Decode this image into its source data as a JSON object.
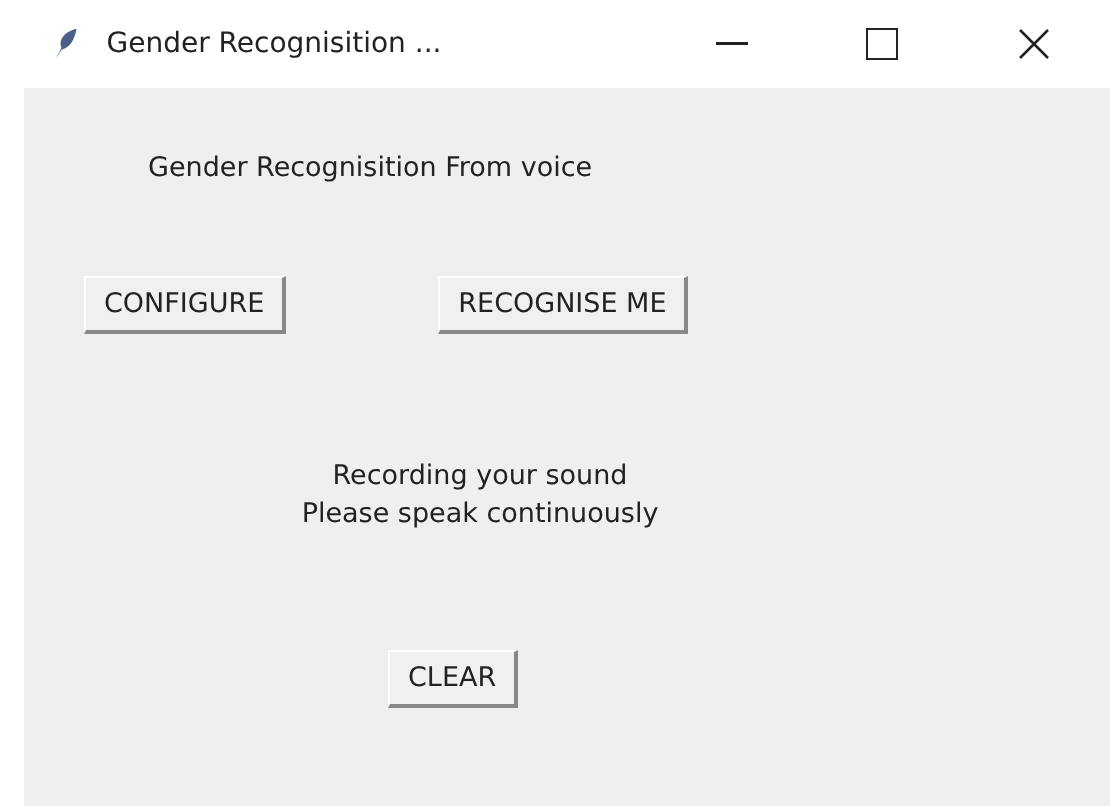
{
  "window": {
    "title": "Gender Recognisition ..."
  },
  "heading": "Gender Recognisition From voice",
  "buttons": [
    "CONFIGURE",
    "RECOGNISE ME"
  ],
  "status": [
    "Recording your sound",
    "Please speak continuously"
  ],
  "clear_button": "CLEAR"
}
